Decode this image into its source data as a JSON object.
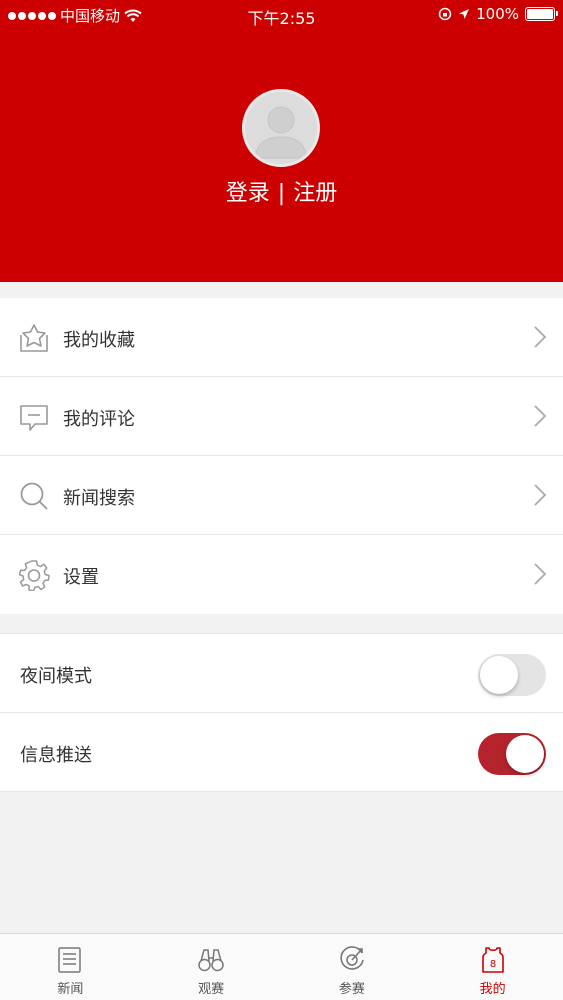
{
  "status_bar": {
    "carrier": "中国移动",
    "time": "下午2:55",
    "battery": "100%"
  },
  "profile": {
    "login_label": "登录",
    "separator": "|",
    "register_label": "注册"
  },
  "menu": {
    "items": [
      {
        "label": "我的收藏",
        "icon": "star-icon"
      },
      {
        "label": "我的评论",
        "icon": "comment-icon"
      },
      {
        "label": "新闻搜索",
        "icon": "search-icon"
      },
      {
        "label": "设置",
        "icon": "gear-icon"
      }
    ]
  },
  "toggles": {
    "items": [
      {
        "label": "夜间模式",
        "state": "off"
      },
      {
        "label": "信息推送",
        "state": "on"
      }
    ]
  },
  "tabbar": {
    "tabs": [
      {
        "label": "新闻",
        "icon": "news-icon",
        "active": false
      },
      {
        "label": "观赛",
        "icon": "binoculars-icon",
        "active": false
      },
      {
        "label": "参赛",
        "icon": "medal-icon",
        "active": false
      },
      {
        "label": "我的",
        "icon": "jersey-icon",
        "active": true
      }
    ]
  },
  "colors": {
    "brand_red": "#cc0000",
    "switch_on": "#b5232d",
    "switch_off": "#e4e4e4"
  }
}
